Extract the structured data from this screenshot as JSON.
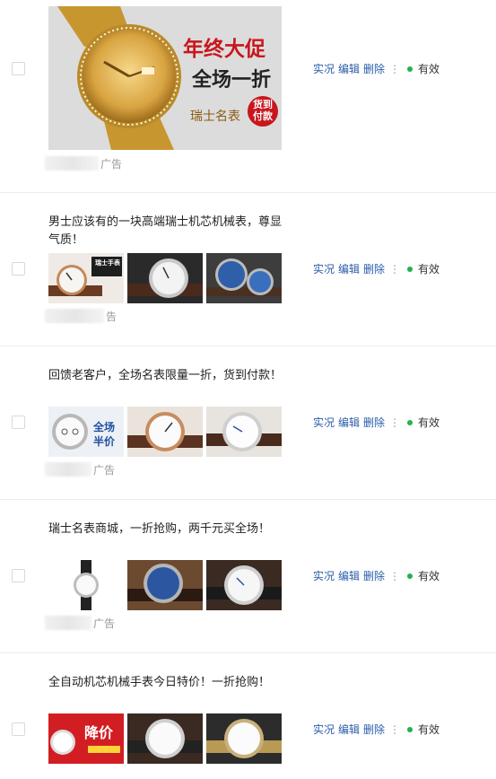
{
  "colors": {
    "link": "#2a5caa",
    "status_dot": "#22b14c",
    "ad_red": "#c8161d"
  },
  "ads": [
    {
      "type": "big",
      "title": "",
      "banner_lines": [
        "年终大促",
        "全场一折",
        "瑞士名表",
        "货到付款"
      ],
      "source_suffix": "广告",
      "actions": {
        "view": "实况",
        "edit": "编辑",
        "delete": "删除",
        "more": "⋮"
      },
      "status": "有效"
    },
    {
      "type": "three",
      "title": "男士应该有的一块高端瑞士机芯机械表，尊显气质！",
      "thumb_text": [
        "瑞士手表"
      ],
      "source_suffix": "告",
      "actions": {
        "view": "实况",
        "edit": "编辑",
        "delete": "删除",
        "more": "⋮"
      },
      "status": "有效"
    },
    {
      "type": "three",
      "title": "回馈老客户，全场名表限量一折，货到付款！",
      "thumb_text": [
        "全场",
        "半价"
      ],
      "source_suffix": "广告",
      "actions": {
        "view": "实况",
        "edit": "编辑",
        "delete": "删除",
        "more": "⋮"
      },
      "status": "有效"
    },
    {
      "type": "three",
      "title": "瑞士名表商城，一折抢购，两千元买全场！",
      "source_suffix": "广告",
      "actions": {
        "view": "实况",
        "edit": "编辑",
        "delete": "删除",
        "more": "⋮"
      },
      "status": "有效"
    },
    {
      "type": "three",
      "title": "全自动机芯机械手表今日特价！一折抢购！",
      "thumb_text": [
        "降价"
      ],
      "source_suffix": "",
      "actions": {
        "view": "实况",
        "edit": "编辑",
        "delete": "删除",
        "more": "⋮"
      },
      "status": "有效"
    }
  ]
}
